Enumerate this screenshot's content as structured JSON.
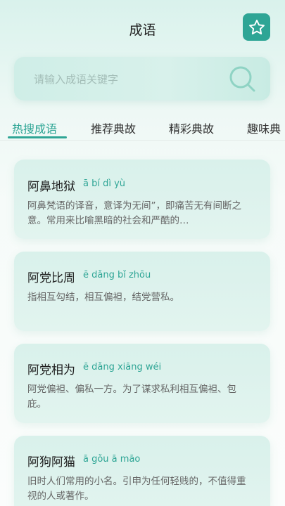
{
  "header": {
    "title": "成语",
    "favorite_icon": "star-icon"
  },
  "search": {
    "placeholder": "请输入成语关键字",
    "icon": "search-icon"
  },
  "tabs": [
    {
      "label": "热搜成语",
      "active": true
    },
    {
      "label": "推荐典故",
      "active": false
    },
    {
      "label": "精彩典故",
      "active": false
    },
    {
      "label": "趣味典",
      "active": false
    }
  ],
  "cards": [
    {
      "title": "阿鼻地狱",
      "pinyin": "ā bí dì yù",
      "desc": "阿鼻梵语的译音，意译为无间”，即痛苦无有间断之意。常用来比喻黑暗的社会和严酷的…"
    },
    {
      "title": "阿党比周",
      "pinyin": "ē dǎng bǐ zhōu",
      "desc": "指相互勾结，相互偏袒，结党营私。"
    },
    {
      "title": "阿党相为",
      "pinyin": "ē dǎng xiāng wéi",
      "desc": "阿党偏袒、偏私一方。为了谋求私利相互偏袒、包庇。"
    },
    {
      "title": "阿狗阿猫",
      "pinyin": "ā gǒu ā māo",
      "desc": "旧时人们常用的小名。引申为任何轻贱的，不值得重视的人或著作。"
    }
  ],
  "colors": {
    "accent": "#2ea595",
    "card_bg": "#dcf2ec"
  }
}
